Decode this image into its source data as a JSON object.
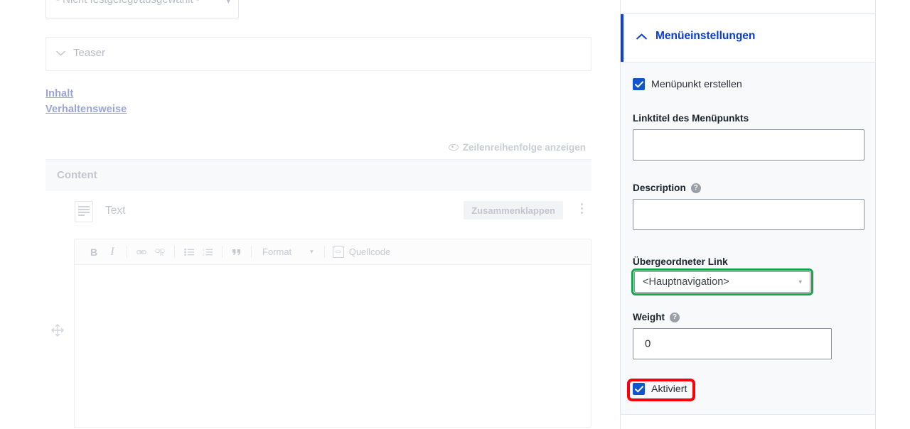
{
  "main": {
    "status_select": {
      "value": "- Nicht festgelegt/ausgewählt -",
      "caret": "chevron-down-icon"
    },
    "teaser": {
      "label": "Teaser",
      "chevron": "chevron-down-icon"
    },
    "vertical_tabs": [
      {
        "label": "Inhalt"
      },
      {
        "label": "Verhaltensweise"
      }
    ],
    "row_order_toggle": {
      "label": "Zeilenreihenfolge anzeigen",
      "icon": "eye-icon"
    },
    "content_section": {
      "label": "Content"
    },
    "paragraph": {
      "icon": "text-paragraph-icon",
      "title": "Text",
      "collapse_label": "Zusammenklappen",
      "menu_icon": "kebab-menu-icon",
      "drag_icon": "move-handle-icon"
    },
    "editor": {
      "buttons": [
        {
          "name": "bold",
          "label": "B"
        },
        {
          "name": "italic",
          "label": "I"
        },
        {
          "name": "link",
          "label": "🔗"
        },
        {
          "name": "unlink",
          "label": "⛓"
        },
        {
          "name": "bulleted-list",
          "label": "☰"
        },
        {
          "name": "numbered-list",
          "label": "≡"
        },
        {
          "name": "blockquote",
          "label": "”"
        }
      ],
      "format_label": "Format",
      "format_caret": "▾",
      "source_label": "Quellcode",
      "body_value": ""
    }
  },
  "sidebar": {
    "section": {
      "title": "Menüeinstellungen",
      "chevron": "chevron-up-icon",
      "accent_color": "#0f3fd8"
    },
    "create_menu_link": {
      "label": "Menüpunkt erstellen",
      "checked": true
    },
    "fields": [
      {
        "label": "Linktitel des Menüpunkts",
        "value": "",
        "has_help": false
      },
      {
        "label": "Description",
        "value": "",
        "has_help": true,
        "help_glyph": "?"
      }
    ],
    "parent_link": {
      "label": "Übergeordneter Link",
      "value": "<Hauptnavigation>",
      "caret": "▾",
      "highlight_color": "#16a34a"
    },
    "weight": {
      "label": "Weight",
      "value": "0",
      "has_help": true,
      "help_glyph": "?"
    },
    "enabled": {
      "label": "Aktiviert",
      "checked": true,
      "highlight_color": "#fb0007"
    }
  }
}
